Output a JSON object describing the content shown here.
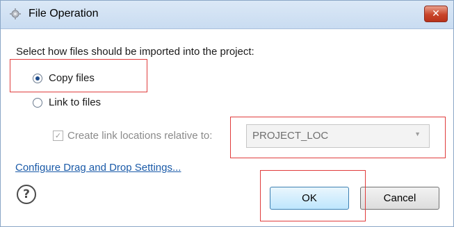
{
  "window": {
    "title": "File Operation",
    "close_label": "✕"
  },
  "prompt": "Select how files should be imported into the project:",
  "options": [
    {
      "label": "Copy files",
      "checked": true
    },
    {
      "label": "Link to files",
      "checked": false
    }
  ],
  "relative": {
    "checkbox_label": "Create link locations relative to:",
    "checked": true,
    "enabled": false,
    "combo_value": "PROJECT_LOC"
  },
  "link_text": "Configure Drag and Drop Settings...",
  "buttons": {
    "ok": "OK",
    "cancel": "Cancel"
  },
  "icons": {
    "app": "gear-icon",
    "help": "help-icon",
    "close": "close-icon",
    "dropdown": "chevron-down-icon"
  },
  "annotation_color": "#e03c3c"
}
